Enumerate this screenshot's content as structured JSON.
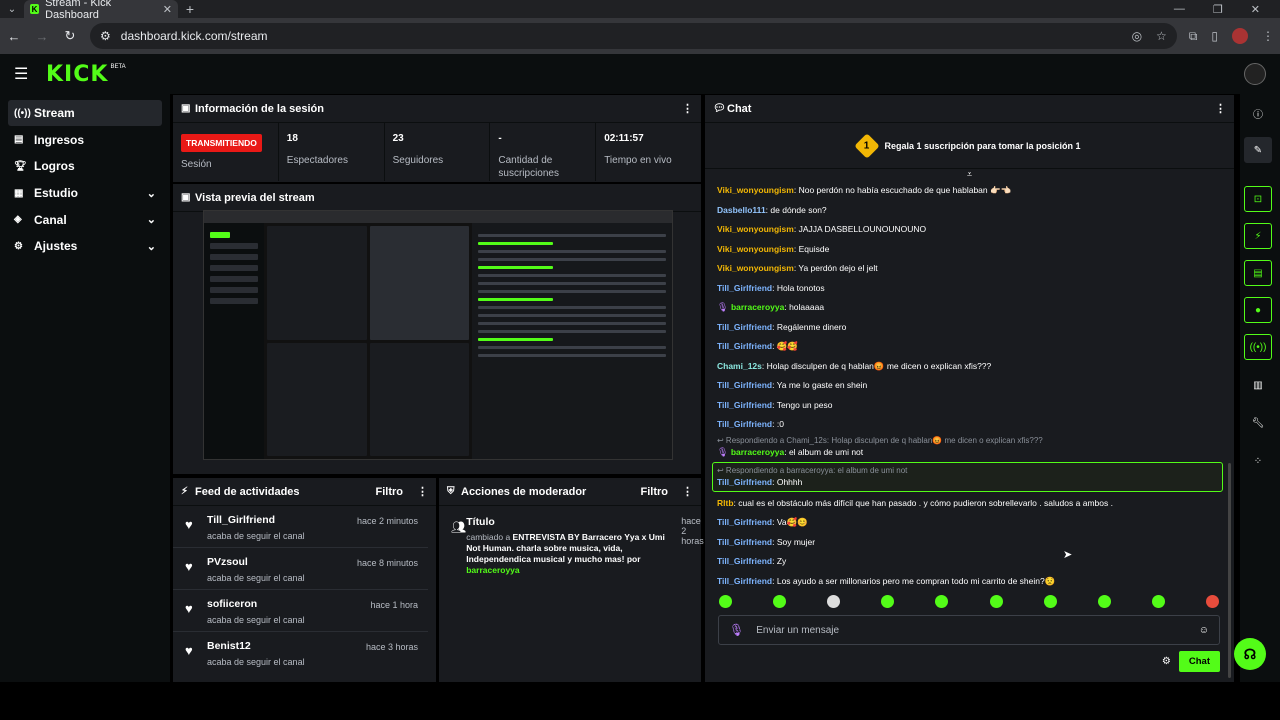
{
  "browser": {
    "tab_title": "Stream - Kick Dashboard",
    "tab_icon": "K",
    "url": "dashboard.kick.com/stream"
  },
  "header": {
    "logo": "KICK",
    "beta": "BETA"
  },
  "sidebar": {
    "items": [
      {
        "label": "Stream",
        "icon": "broadcast-icon"
      },
      {
        "label": "Ingresos",
        "icon": "money-icon"
      },
      {
        "label": "Logros",
        "icon": "trophy-icon"
      },
      {
        "label": "Estudio",
        "icon": "studio-icon"
      },
      {
        "label": "Canal",
        "icon": "channel-icon"
      },
      {
        "label": "Ajustes",
        "icon": "gear-icon"
      }
    ]
  },
  "session": {
    "title": "Información de la sesión",
    "badge": "TRANSMITIENDO",
    "badge_label": "Sesión",
    "stats": [
      {
        "value": "18",
        "label": "Espectadores"
      },
      {
        "value": "23",
        "label": "Seguidores"
      },
      {
        "value": "-",
        "label": "Cantidad de suscripciones"
      },
      {
        "value": "02:11:57",
        "label": "Tiempo en vivo"
      }
    ]
  },
  "preview": {
    "title": "Vista previa del stream"
  },
  "feed": {
    "title": "Feed de actividades",
    "filter": "Filtro",
    "items": [
      {
        "name": "Till_Girlfriend",
        "sub": "acaba de seguir el canal",
        "time": "hace 2 minutos"
      },
      {
        "name": "PVzsoul",
        "sub": "acaba de seguir el canal",
        "time": "hace 8 minutos"
      },
      {
        "name": "sofiiceron",
        "sub": "acaba de seguir el canal",
        "time": "hace 1 hora"
      },
      {
        "name": "Benist12",
        "sub": "acaba de seguir el canal",
        "time": "hace 3 horas"
      }
    ]
  },
  "mod": {
    "title": "Acciones de moderador",
    "filter": "Filtro",
    "item": {
      "title": "Título",
      "time": "hace 2 horas",
      "pre": "cambiado a ",
      "bold": "ENTREVISTA BY Barracero Yya x Umi Not Human. charla sobre musica, vida, Independendica musical y mucho mas!",
      "mid": " por ",
      "user": "barraceroyya"
    }
  },
  "chat": {
    "title": "Chat",
    "gift_rank": "1",
    "gift_text": "Regala 1 suscripción para tomar la posición 1",
    "messages": [
      {
        "user": "Viki_wonyoungism",
        "cls": "u-y",
        "text": "Noo perdón no había escuchado de que hablaban 👉🏻👈🏻"
      },
      {
        "user": "Dasbello111",
        "cls": "u-c",
        "text": "de dónde son?"
      },
      {
        "user": "Viki_wonyoungism",
        "cls": "u-y",
        "text": "JAJJA DASBELLOUNOUNOUNO"
      },
      {
        "user": "Viki_wonyoungism",
        "cls": "u-y",
        "text": "Equisde"
      },
      {
        "user": "Viki_wonyoungism",
        "cls": "u-y",
        "text": "Ya perdón dejo el jelt"
      },
      {
        "user": "Till_Girlfriend",
        "cls": "u-b",
        "text": "Hola tonotos"
      },
      {
        "user": "barraceroyya",
        "cls": "u-g",
        "text": "holaaaaa",
        "mic": true
      },
      {
        "user": "Till_Girlfriend",
        "cls": "u-b",
        "text": "Regálenme dinero"
      },
      {
        "user": "Till_Girlfriend",
        "cls": "u-b",
        "text": "🥰🥰"
      },
      {
        "user": "Chami_12s",
        "cls": "u-t",
        "text": "Holap disculpen de q hablan😡 me dicen o explican xfis???"
      },
      {
        "user": "Till_Girlfriend",
        "cls": "u-b",
        "text": "Ya me lo gaste en shein"
      },
      {
        "user": "Till_Girlfriend",
        "cls": "u-b",
        "text": "Tengo un peso"
      },
      {
        "user": "Till_Girlfriend",
        "cls": "u-b",
        "text": ":0"
      }
    ],
    "reply1": {
      "ref": "↩ Respondiendo a Chami_12s: Holap disculpen de q hablan😡 me dicen o explican xfis???",
      "user": "barraceroyya",
      "text": "el album de umi not"
    },
    "reply2": {
      "ref": "↩ Respondiendo a barraceroyya: el album de umi not",
      "user": "Till_Girlfriend",
      "text": "Ohhhh"
    },
    "messages2": [
      {
        "user": "Rltb",
        "cls": "u-y",
        "text": "cual es el obstáculo más difícil que han pasado . y cómo pudieron sobrellevarlo . saludos a ambos ."
      },
      {
        "user": "Till_Girlfriend",
        "cls": "u-b",
        "text": "Va🥰😊"
      },
      {
        "user": "Till_Girlfriend",
        "cls": "u-b",
        "text": "Soy mujer"
      },
      {
        "user": "Till_Girlfriend",
        "cls": "u-b",
        "text": "Zy"
      },
      {
        "user": "Till_Girlfriend",
        "cls": "u-b",
        "text": "Los ayudo a ser millonarios pero me compran todo mi carrito de shein?😟"
      }
    ],
    "input_placeholder": "Enviar un mensaje",
    "send_label": "Chat"
  },
  "colors": {
    "accent": "#53fc18",
    "live": "#e91916",
    "panel": "#191b1f"
  }
}
